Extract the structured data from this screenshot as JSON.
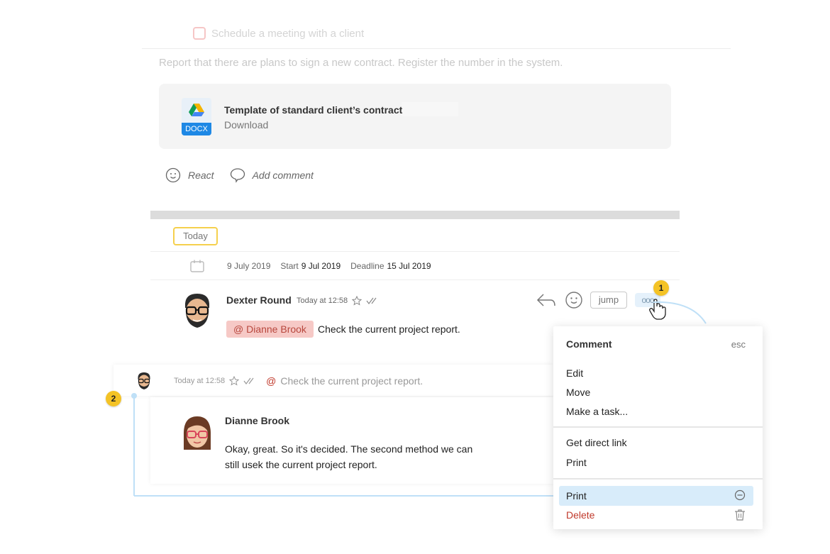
{
  "task": {
    "checklist_item": "Schedule a meeting with a client"
  },
  "description": "Report that there are plans to sign a new contract. Register the number in the system.",
  "attachment": {
    "type_label": "DOCX",
    "name": "Template of standard client’s contract",
    "action": "Download"
  },
  "post_actions": {
    "react": "React",
    "comment": "Add comment"
  },
  "timeline": {
    "today_label": "Today",
    "date": "9 July 2019",
    "start_label": "Start",
    "start_value": "9 Jul 2019",
    "deadline_label": "Deadline",
    "deadline_value": "15 Jul 2019"
  },
  "message": {
    "author": "Dexter Round",
    "time": "Today at 12:58",
    "mention": "@ Dianne Brook",
    "text": "Check the current project report.",
    "jump_label": "jump",
    "more_label": "ooo"
  },
  "reply_preview": {
    "time": "Today at 12:58",
    "at_symbol": "@",
    "text": "Check the current project report."
  },
  "reply": {
    "author": "Dianne Brook",
    "text": "Okay, great. So it's decided. The second method we can still usek the current project report."
  },
  "menu": {
    "header": "Comment",
    "esc": "esc",
    "items_group1": [
      "Edit",
      "Move",
      "Make a task..."
    ],
    "items_group2": [
      "Get direct link",
      "Print"
    ],
    "print_highlight": "Print",
    "delete": "Delete"
  },
  "badges": {
    "one": "1",
    "two": "2"
  },
  "colors": {
    "accent_blue": "#bfe0f7",
    "badge_yellow": "#f4c326",
    "mention_bg": "#f6c9c6",
    "delete_red": "#c0392b"
  }
}
